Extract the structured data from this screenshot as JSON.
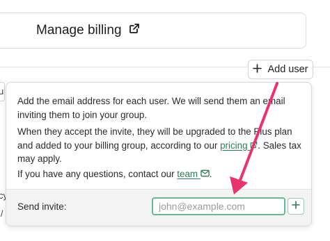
{
  "header": {
    "manage_billing_label": "Manage billing"
  },
  "toolbar": {
    "add_user_label": "Add user"
  },
  "left_fragments": {
    "a": "u",
    "b": "cy",
    "c": "’/"
  },
  "popover": {
    "para1": "Add the email address for each user. We will send them an email inviting them to join your group.",
    "para2_before": "When they accept the invite, they will be upgraded to the Plus plan and added to your billing group, according to our ",
    "pricing_link": "pricing",
    "para2_after": ". Sales tax may apply.",
    "para3_before": "If you have any questions, contact our ",
    "team_link": "team",
    "para3_after": "."
  },
  "invite": {
    "label": "Send invite:",
    "placeholder": "john@example.com",
    "value": ""
  },
  "colors": {
    "accent_green": "#2a7d55",
    "focus_border": "#66b88e",
    "annotation_arrow": "#e8336c"
  },
  "icons": {
    "manage_billing": "external-link-icon",
    "add_user": "plus-icon",
    "pricing": "external-link-icon",
    "team": "mail-icon",
    "send": "plus-icon"
  }
}
